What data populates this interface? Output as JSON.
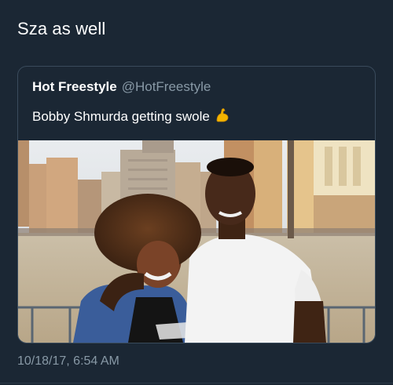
{
  "tweet": {
    "text": "Sza as well",
    "timestamp": "10/18/17, 6:54 AM"
  },
  "quoted_tweet": {
    "name": "Hot Freestyle",
    "handle": "@HotFreestyle",
    "text": "Bobby Shmurda getting swole",
    "emoji": "flexed-biceps-icon"
  },
  "colors": {
    "background": "#1b2734",
    "secondary_text": "#8899a6",
    "border": "#3a4b5c"
  }
}
